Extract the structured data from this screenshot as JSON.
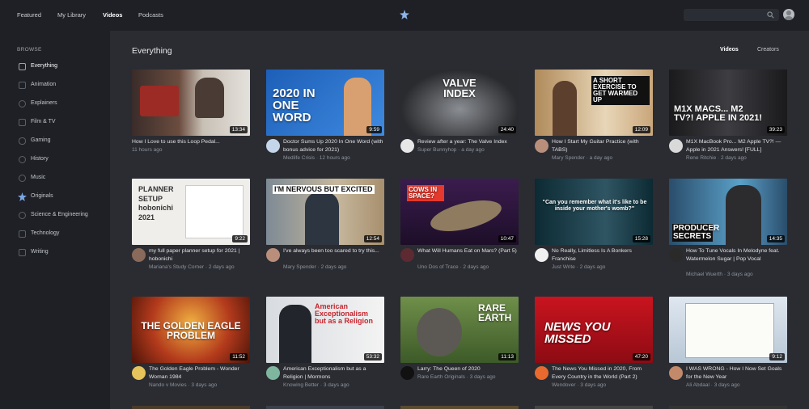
{
  "nav": {
    "featured": "Featured",
    "library": "My Library",
    "videos": "Videos",
    "podcasts": "Podcasts"
  },
  "sidebar": {
    "heading": "BROWSE",
    "items": [
      {
        "label": "Everything",
        "icon": "play-square-icon"
      },
      {
        "label": "Animation",
        "icon": "animation-icon"
      },
      {
        "label": "Explainers",
        "icon": "lightbulb-icon"
      },
      {
        "label": "Film & TV",
        "icon": "film-icon"
      },
      {
        "label": "Gaming",
        "icon": "gamepad-icon"
      },
      {
        "label": "History",
        "icon": "history-icon"
      },
      {
        "label": "Music",
        "icon": "music-icon"
      },
      {
        "label": "Originals",
        "icon": "star-icon"
      },
      {
        "label": "Science & Engineering",
        "icon": "atom-icon"
      },
      {
        "label": "Technology",
        "icon": "chip-icon"
      },
      {
        "label": "Writing",
        "icon": "pen-icon"
      }
    ]
  },
  "main": {
    "title": "Everything",
    "toggle_videos": "Videos",
    "toggle_creators": "Creators",
    "videos": [
      {
        "title": "How I Love to use this Loop Pedal...",
        "channel": "",
        "age": "11 hours ago",
        "duration": "13:34",
        "overlay": ""
      },
      {
        "title": "Doctor Sums Up 2020 In One Word (with bonus advice for 2021)",
        "channel": "Medlife Crisis",
        "age": "12 hours ago",
        "duration": "9:59",
        "overlay": "2020 IN ONE WORD"
      },
      {
        "title": "Review after a year: The Valve Index",
        "channel": "Super Bunnyhop",
        "age": "a day ago",
        "duration": "24:40",
        "overlay": "VALVE INDEX"
      },
      {
        "title": "How I Start My Guitar Practice (with TABS)",
        "channel": "Mary Spender",
        "age": "a day ago",
        "duration": "12:09",
        "overlay": "A SHORT EXERCISE TO GET WARMED UP"
      },
      {
        "title": "M1X MacBook Pro... M2 Apple TV?! — Apple in 2021 Answers! [FULL]",
        "channel": "Rene Ritchie",
        "age": "2 days ago",
        "duration": "39:23",
        "overlay": "M1X MACS... M2 TV?! APPLE IN 2021!"
      },
      {
        "title": "my full paper planner setup for 2021 | hobonichi",
        "channel": "Mariana's Study Corner",
        "age": "2 days ago",
        "duration": "9:22",
        "overlay": "PLANNER SETUP hobonichi 2021"
      },
      {
        "title": "I've always been too scared to try this...",
        "channel": "Mary Spender",
        "age": "2 days ago",
        "duration": "12:54",
        "overlay": "I'M NERVOUS BUT EXCITED"
      },
      {
        "title": "What Will Humans Eat on Mars? (Part 5)",
        "channel": "Uno Dos of Trace",
        "age": "2 days ago",
        "duration": "10:47",
        "overlay": "COWS IN SPACE?"
      },
      {
        "title": "No Really, Limitless Is A Bonkers Franchise",
        "channel": "Just Write",
        "age": "2 days ago",
        "duration": "15:28",
        "overlay": "\"Can you remember what it's like to be inside your mother's womb?\""
      },
      {
        "title": "How To Tune Vocals In Melodyne feat. Watermelon Sugar | Pop Vocal Production [Producer Secrets]",
        "channel": "Michael Wuerth",
        "age": "3 days ago",
        "duration": "14:35",
        "overlay": "PRODUCER SECRETS"
      },
      {
        "title": "The Golden Eagle Problem - Wonder Woman 1984",
        "channel": "Nando v Movies",
        "age": "3 days ago",
        "duration": "11:52",
        "overlay": "THE GOLDEN EAGLE PROBLEM"
      },
      {
        "title": "American Exceptionalism but as a Religion | Mormons",
        "channel": "Knowing Better",
        "age": "3 days ago",
        "duration": "53:32",
        "overlay": "American Exceptionalism but as a Religion"
      },
      {
        "title": "Larry: The Queen of 2020",
        "channel": "Rare Earth Originals",
        "age": "3 days ago",
        "duration": "11:13",
        "overlay": "RARE EARTH"
      },
      {
        "title": "The News You Missed in 2020, From Every Country in the World (Part 2)",
        "channel": "Wendover",
        "age": "3 days ago",
        "duration": "47:20",
        "overlay": "NEWS YOU MISSED"
      },
      {
        "title": "I WAS WRONG - How I Now Set Goals for the New Year",
        "channel": "Ali Abdaal",
        "age": "3 days ago",
        "duration": "9:12",
        "overlay": ""
      }
    ]
  },
  "colors": {
    "bg": "#1e2025",
    "main_bg": "#2a2c32",
    "accent": "#7aa6e0"
  }
}
